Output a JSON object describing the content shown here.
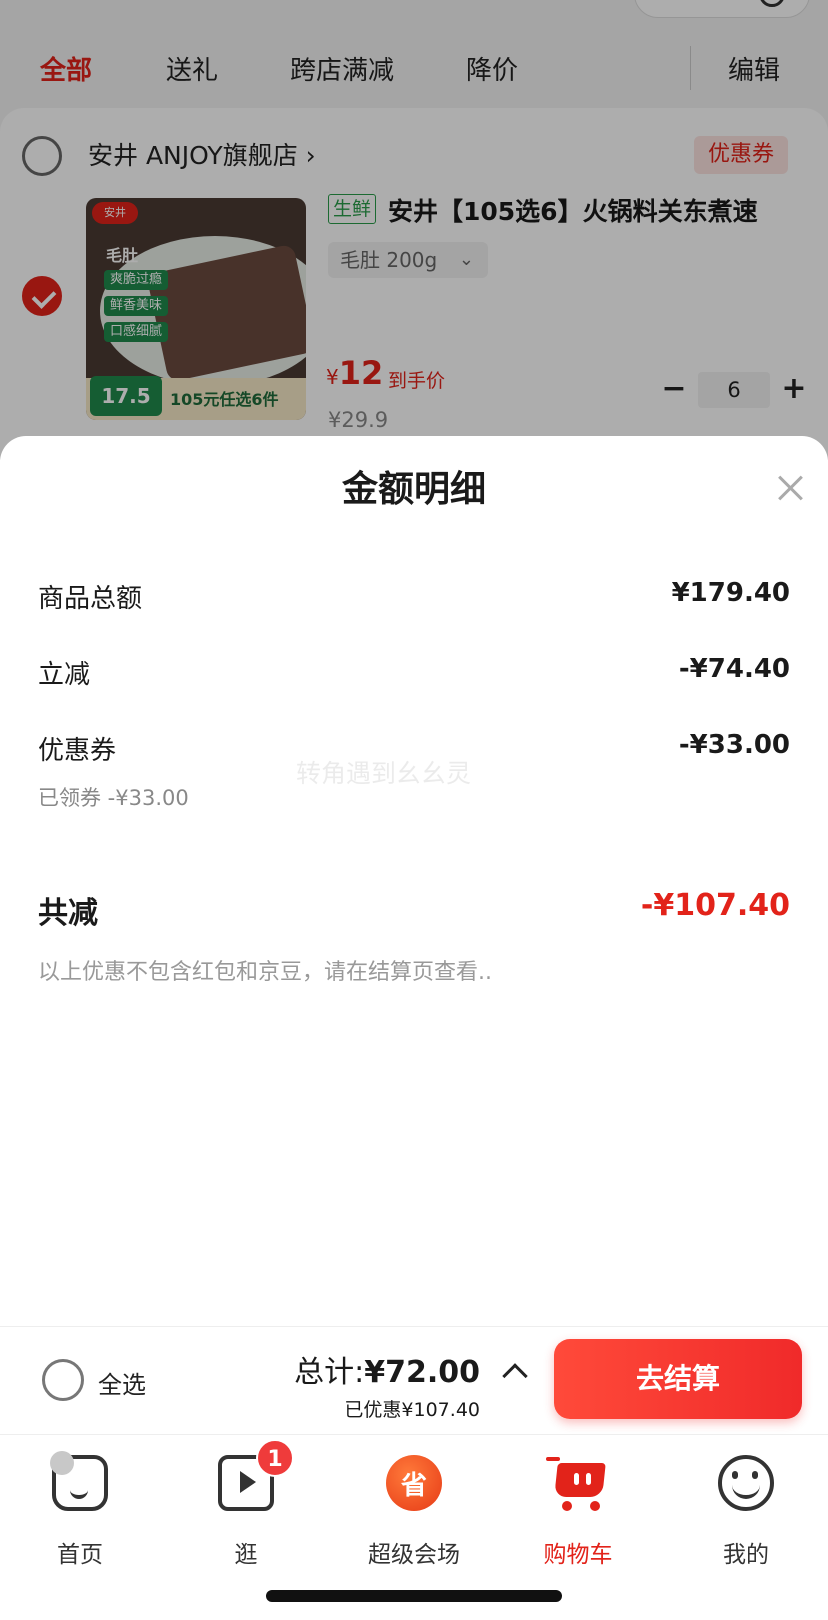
{
  "filters": {
    "tabs": [
      "全部",
      "送礼",
      "跨店满减",
      "降价"
    ],
    "edit_label": "编辑"
  },
  "store": {
    "name": "安井 ANJOY旗舰店 ›",
    "coupon_tag": "优惠券"
  },
  "product": {
    "fresh_tag": "生鲜",
    "title": "安井【105选6】火锅料关东煮速",
    "spec": "毛肚 200g",
    "price_symbol": "¥",
    "price_value": "12",
    "price_label": "到手价",
    "original_price": "¥29.9",
    "quantity": "6",
    "image": {
      "brand": "安井",
      "name": "毛肚",
      "tags": [
        "爽脆过瘾",
        "鲜香美味",
        "口感细腻"
      ],
      "banner": "105元任选6件",
      "price_badge": "17.5"
    }
  },
  "sheet": {
    "title": "金额明细",
    "rows": [
      {
        "label": "商品总额",
        "value": "¥179.40"
      },
      {
        "label": "立减",
        "value": "-¥74.40"
      },
      {
        "label": "优惠券",
        "value": "-¥33.00"
      }
    ],
    "coupon_note": "已领券 -¥33.00",
    "watermark": "转角遇到幺幺灵",
    "total_label": "共减",
    "total_value": "-¥107.40",
    "disclaimer": "以上优惠不包含红包和京豆，请在结算页查看.."
  },
  "checkout": {
    "select_all": "全选",
    "sum_prefix": "总计:",
    "sum_value": "¥72.00",
    "saved": "已优惠¥107.40",
    "button": "去结算"
  },
  "tabbar": {
    "items": [
      {
        "label": "首页",
        "icon": "home-icon"
      },
      {
        "label": "逛",
        "icon": "play-icon",
        "badge": "1"
      },
      {
        "label": "超级会场",
        "icon": "venue-icon"
      },
      {
        "label": "购物车",
        "icon": "cart-icon"
      },
      {
        "label": "我的",
        "icon": "me-icon"
      }
    ]
  },
  "colors": {
    "accent": "#e2231a",
    "fresh_green": "#2a9d4a"
  }
}
